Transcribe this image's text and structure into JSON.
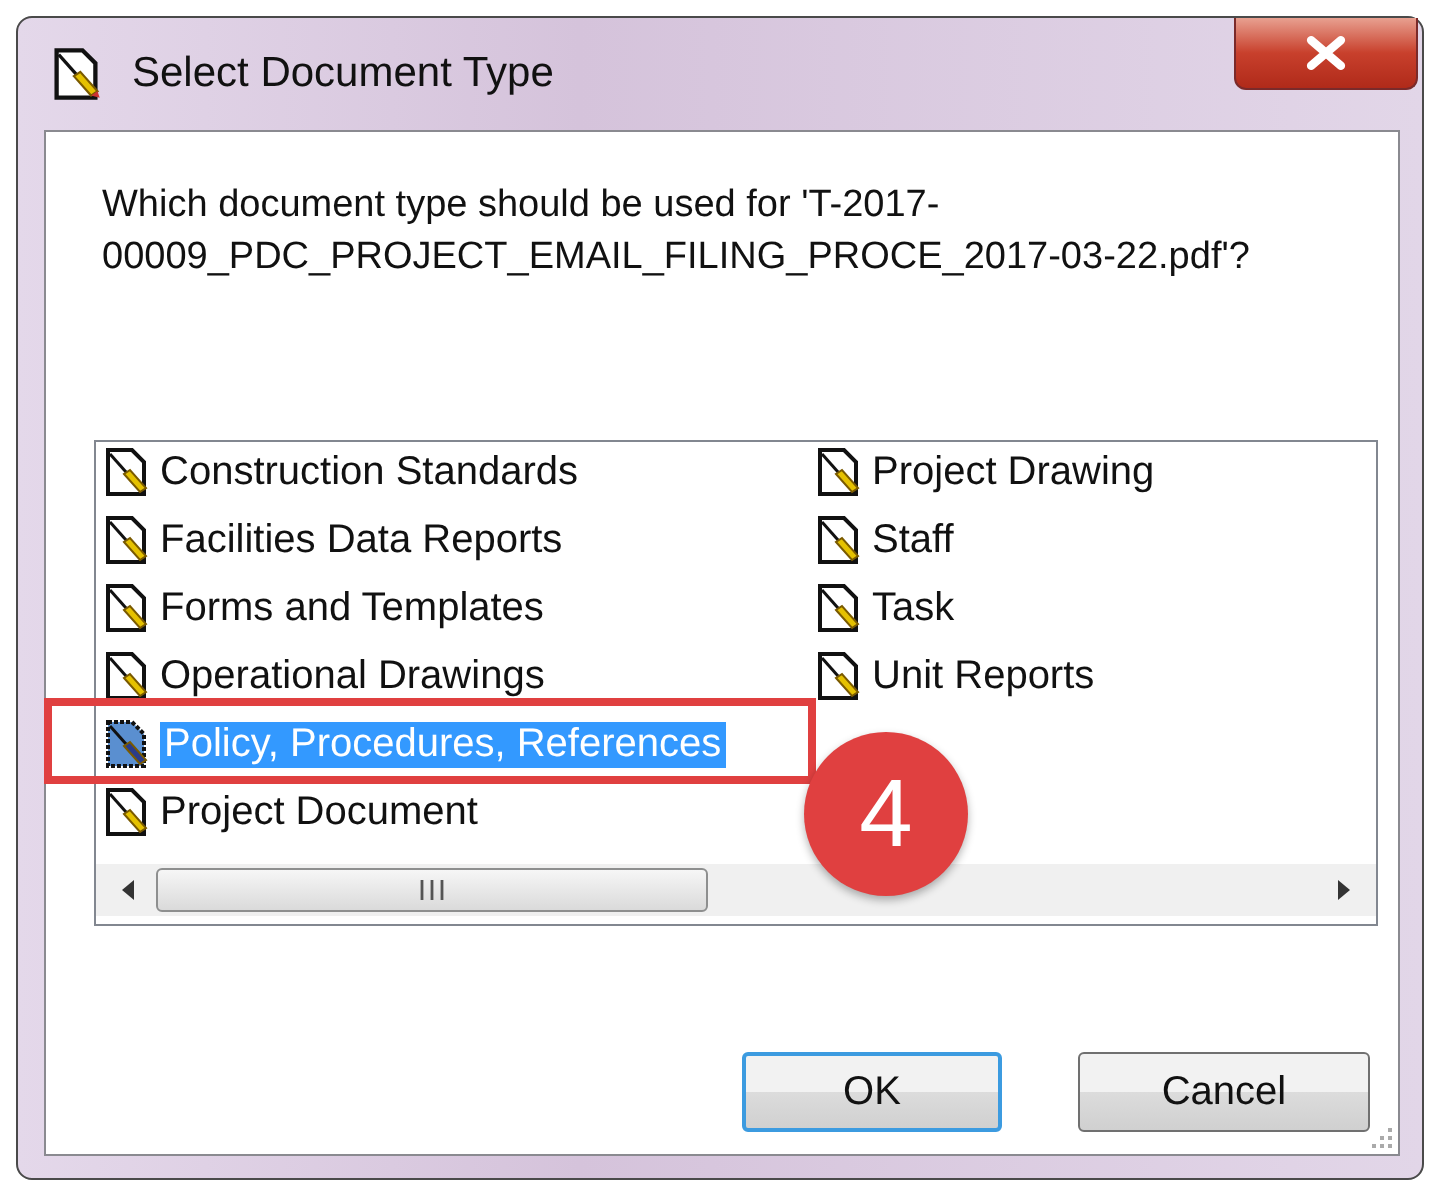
{
  "window": {
    "title": "Select Document Type"
  },
  "message": "Which document type should be used for 'T-2017-00009_PDC_PROJECT_EMAIL_FILING_PROCE_2017-03-22.pdf'?",
  "document_types": [
    {
      "label": "Construction Standards",
      "selected": false
    },
    {
      "label": "Facilities Data Reports",
      "selected": false
    },
    {
      "label": "Forms and Templates",
      "selected": false
    },
    {
      "label": "Operational Drawings",
      "selected": false
    },
    {
      "label": "Policy, Procedures, References",
      "selected": true
    },
    {
      "label": "Project Document",
      "selected": false
    },
    {
      "label": "Project Drawing",
      "selected": false
    },
    {
      "label": "Staff",
      "selected": false
    },
    {
      "label": "Task",
      "selected": false
    },
    {
      "label": "Unit Reports",
      "selected": false
    }
  ],
  "callout": {
    "label": "4"
  },
  "buttons": [
    {
      "label": "OK",
      "kind": "default"
    },
    {
      "label": "Cancel",
      "kind": "normal"
    }
  ]
}
